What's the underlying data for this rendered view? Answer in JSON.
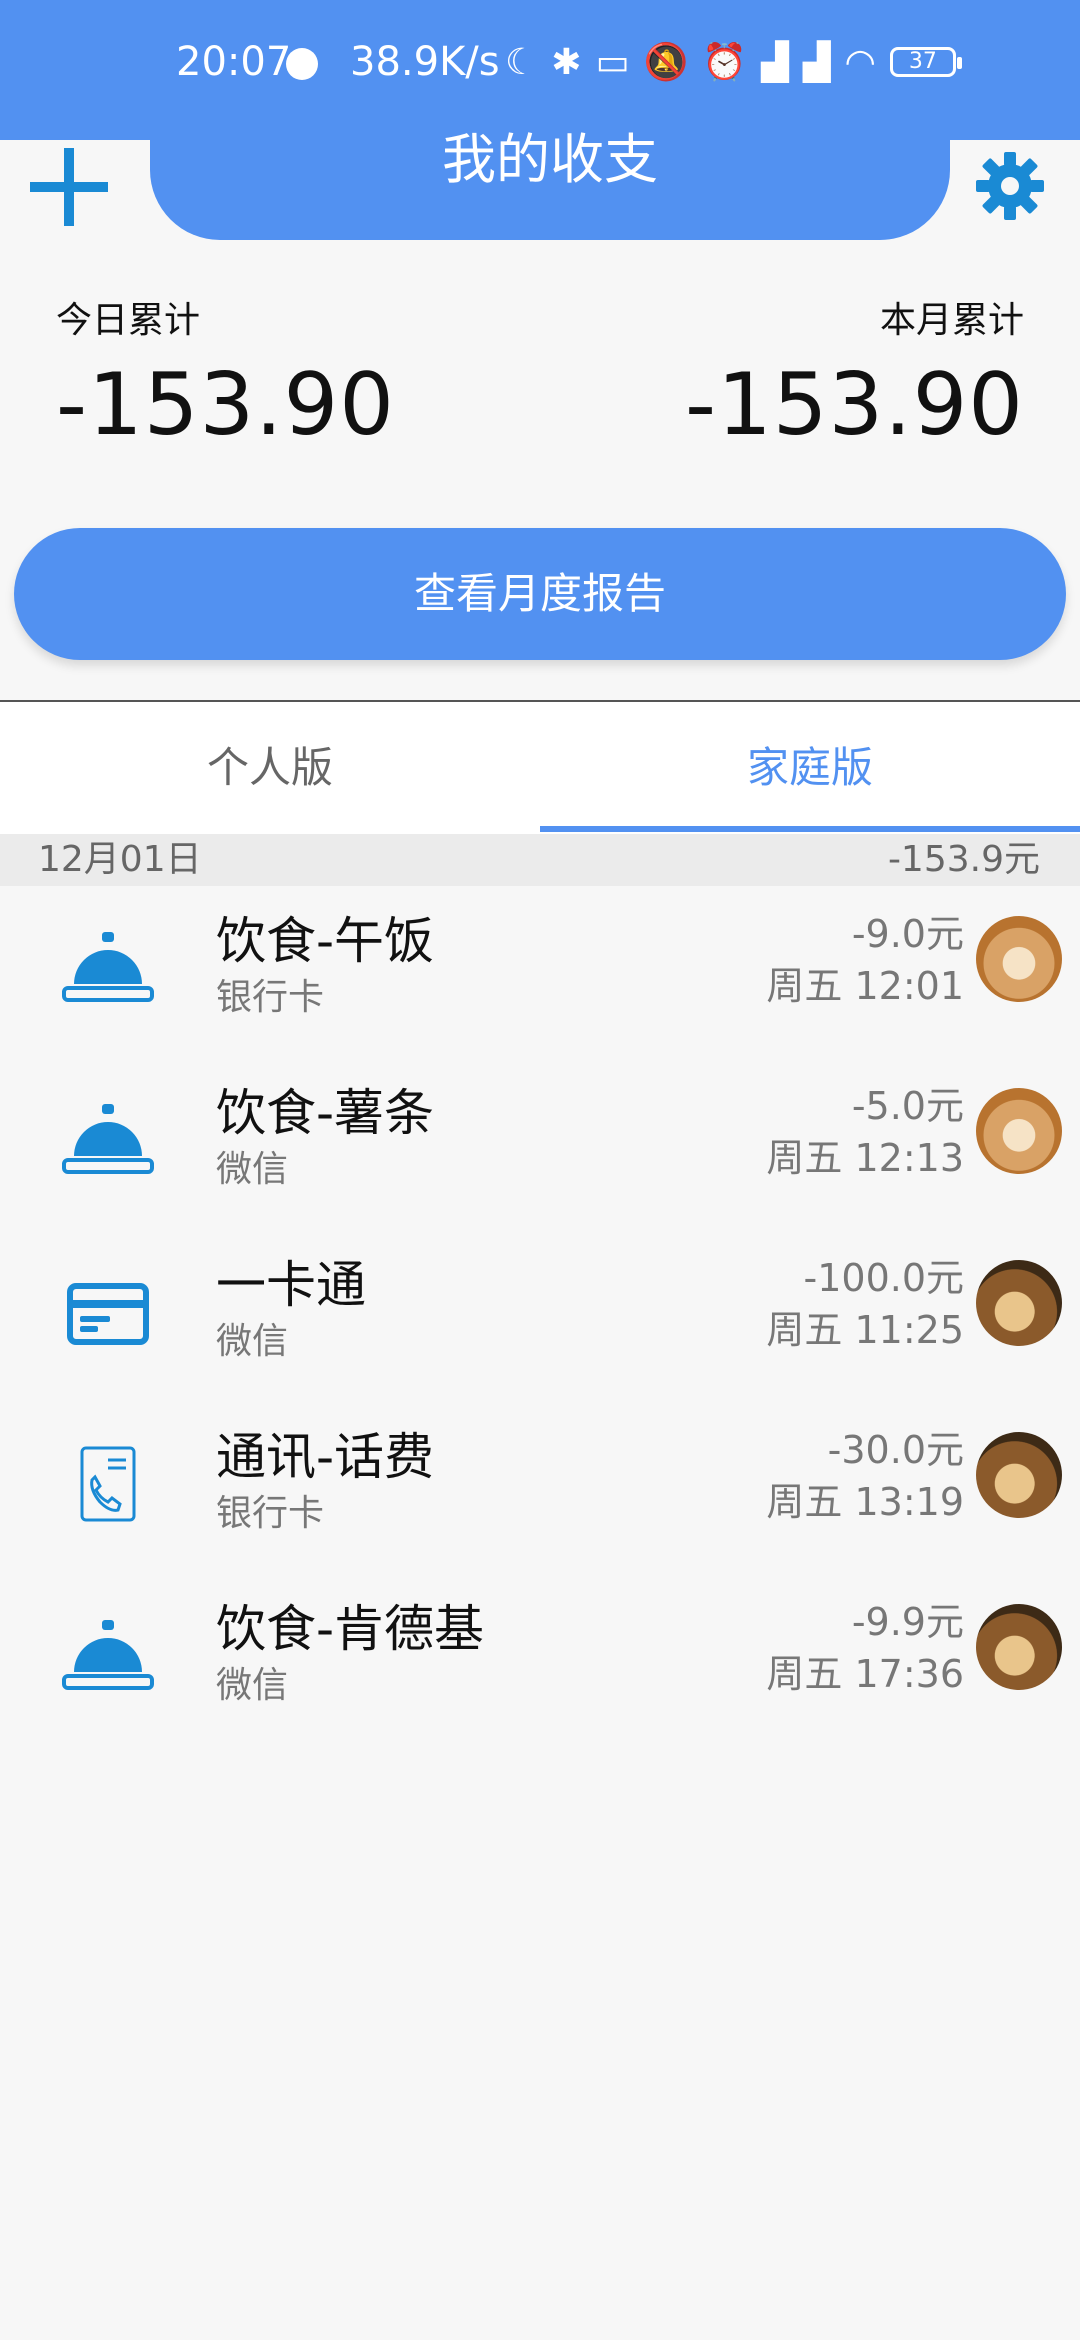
{
  "status_bar": {
    "time": "20:07",
    "speed": "38.9K/s",
    "battery": "37"
  },
  "header": {
    "title": "我的收支"
  },
  "summary": {
    "today_label": "今日累计",
    "today_value": "-153.90",
    "month_label": "本月累计",
    "month_value": "-153.90"
  },
  "report_button": "查看月度报告",
  "tabs": [
    {
      "label": "个人版",
      "active": false
    },
    {
      "label": "家庭版",
      "active": true
    }
  ],
  "colors": {
    "accent": "#5291f1",
    "icon_blue": "#1a8ad4"
  },
  "date_group": {
    "date": "12月01日",
    "total": "-153.9元"
  },
  "items": [
    {
      "icon": "food-cloche-icon",
      "title": "饮食-午饭",
      "account": "银行卡",
      "amount": "-9.0元",
      "time": "周五 12:01"
    },
    {
      "icon": "food-cloche-icon",
      "title": "饮食-薯条",
      "account": "微信",
      "amount": "-5.0元",
      "time": "周五 12:13"
    },
    {
      "icon": "card-icon",
      "title": "一卡通",
      "account": "微信",
      "amount": "-100.0元",
      "time": "周五 11:25"
    },
    {
      "icon": "phone-bill-icon",
      "title": "通讯-话费",
      "account": "银行卡",
      "amount": "-30.0元",
      "time": "周五 13:19"
    },
    {
      "icon": "food-cloche-icon",
      "title": "饮食-肯德基",
      "account": "微信",
      "amount": "-9.9元",
      "time": "周五 17:36"
    }
  ]
}
